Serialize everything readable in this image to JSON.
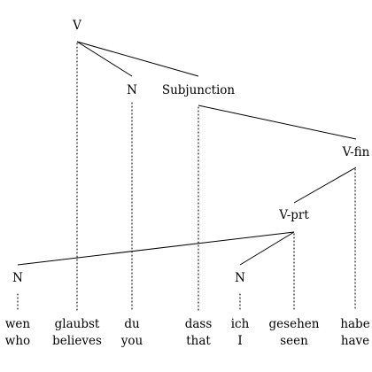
{
  "tree": {
    "nodes": [
      {
        "id": "V",
        "label": "V"
      },
      {
        "id": "N1",
        "label": "N"
      },
      {
        "id": "SUBJ",
        "label": "Subjunction"
      },
      {
        "id": "VFIN",
        "label": "V-fin"
      },
      {
        "id": "VPRT",
        "label": "V-prt"
      },
      {
        "id": "N2",
        "label": "N"
      },
      {
        "id": "N3",
        "label": "N"
      }
    ],
    "words": [
      {
        "german": "wen",
        "gloss": "who"
      },
      {
        "german": "glaubst",
        "gloss": "believes"
      },
      {
        "german": "du",
        "gloss": "you"
      },
      {
        "german": "dass",
        "gloss": "that"
      },
      {
        "german": "ich",
        "gloss": "I"
      },
      {
        "german": "gesehen",
        "gloss": "seen"
      },
      {
        "german": "habe",
        "gloss": "have"
      }
    ],
    "edges": [
      [
        "V",
        "N1"
      ],
      [
        "V",
        "SUBJ"
      ],
      [
        "SUBJ",
        "VFIN"
      ],
      [
        "VFIN",
        "VPRT"
      ],
      [
        "VPRT",
        "N2"
      ],
      [
        "VPRT",
        "N3"
      ]
    ],
    "projections": [
      [
        "N2",
        0
      ],
      [
        "V",
        1
      ],
      [
        "N1",
        2
      ],
      [
        "SUBJ",
        3
      ],
      [
        "N3",
        4
      ],
      [
        "VPRT",
        5
      ],
      [
        "VFIN",
        6
      ]
    ]
  }
}
